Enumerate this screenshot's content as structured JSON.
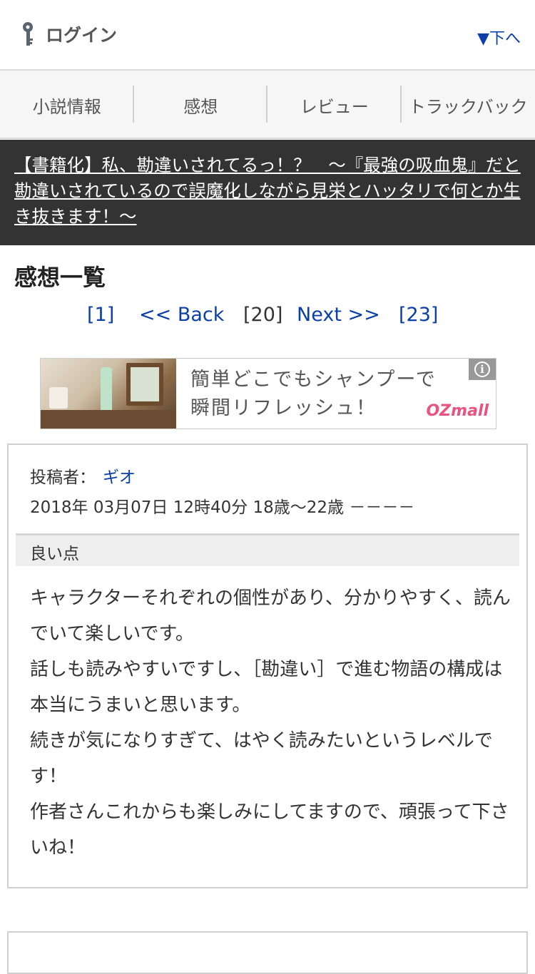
{
  "header": {
    "login_label": "ログイン",
    "down_link": "▼下へ"
  },
  "tabs": [
    {
      "label": "小説情報"
    },
    {
      "label": "感想"
    },
    {
      "label": "レビュー"
    },
    {
      "label": "トラックバック"
    }
  ],
  "novel_title": "【書籍化】私、勘違いされてるっ！？　〜『最強の吸血鬼』だと勘違いされているので誤魔化しながら見栄とハッタリで何とか生き抜きます！〜",
  "section_heading": "感想一覧",
  "pagination": {
    "first": "[1]",
    "back": "<< Back",
    "current": "[20]",
    "next": "Next >>",
    "last": "[23]"
  },
  "ad": {
    "line1": "簡単どこでもシャンプーで",
    "line2": "瞬間リフレッシュ！",
    "brand": "OZmall",
    "info_glyph": "i"
  },
  "review": {
    "poster_label": "投稿者：",
    "poster_name": "ギオ",
    "meta": "2018年 03月07日 12時40分 18歳～22歳 －－－－",
    "good_points_label": "良い点",
    "body_lines": [
      "キャラクターそれぞれの個性があり、分かりやすく、読んでいて楽しいです。",
      "話しも読みやすいですし、［勘違い］で進む物語の構成は本当にうまいと思います。",
      "続きが気になりすぎて、はやく読みたいというレベルです！",
      "作者さんこれからも楽しみにしてますので、頑張って下さいね！"
    ]
  },
  "colors": {
    "link": "#0a3fa8",
    "banner_bg": "#333333",
    "brand_pink": "#e8547f"
  }
}
